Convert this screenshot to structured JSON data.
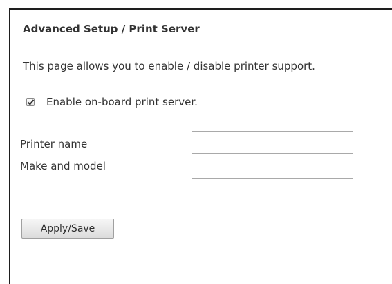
{
  "page": {
    "title": "Advanced Setup / Print Server",
    "description": "This page allows you to enable / disable printer support."
  },
  "print_server": {
    "enable_label": "Enable on-board print server.",
    "enabled": true
  },
  "fields": {
    "printer_name_label": "Printer name",
    "printer_name_value": "",
    "make_model_label": "Make and model",
    "make_model_value": ""
  },
  "actions": {
    "apply_label": "Apply/Save"
  }
}
